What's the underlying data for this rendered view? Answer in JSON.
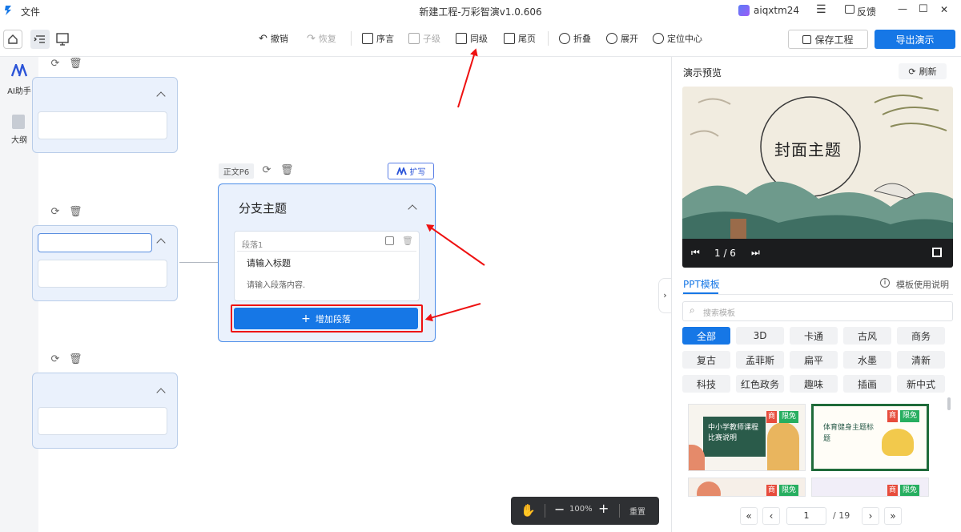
{
  "titlebar": {
    "menu_file": "文件",
    "window_title": "新建工程-万彩智演v1.0.606",
    "username": "aiqxtm24",
    "feedback": "反馈",
    "min": "—",
    "max": "☐",
    "close": "✕"
  },
  "toolbar": {
    "undo": "撤销",
    "redo": "恢复",
    "preface": "序言",
    "child": "子级",
    "sibling": "同级",
    "epilogue": "尾页",
    "collapse": "折叠",
    "expand": "展开",
    "locate": "定位中心",
    "save": "保存工程",
    "export": "导出演示"
  },
  "sidebar": {
    "ai": "AI助手",
    "outline": "大纲"
  },
  "canvas": {
    "node_tag": "正文P6",
    "expand_btn": "扩写",
    "branch_title": "分支主题",
    "para_label": "段落1",
    "para_title_placeholder": "请输入标题",
    "para_content_placeholder": "请输入段落内容.",
    "add_para": "增加段落"
  },
  "zoom": {
    "level": "100%",
    "reset": "重置"
  },
  "preview": {
    "title": "演示预览",
    "refresh": "刷新",
    "slide_title": "封面主题",
    "counter": "1 / 6"
  },
  "templates": {
    "tab": "PPT模板",
    "help": "模板使用说明",
    "search_placeholder": "搜索模板",
    "categories": [
      "全部",
      "3D",
      "卡通",
      "古风",
      "商务",
      "复古",
      "孟菲斯",
      "扁平",
      "水墨",
      "清新",
      "科技",
      "红色政务",
      "趣味",
      "插画",
      "新中式"
    ],
    "badge_shang": "商",
    "badge_free": "限免",
    "card1_text": "中小学教师课程比赛说明",
    "card2_text": "体育健身主题标题",
    "page_current": "1",
    "page_total": "/ 19"
  },
  "colors": {
    "accent": "#1677e6",
    "annotation": "#e11111"
  }
}
